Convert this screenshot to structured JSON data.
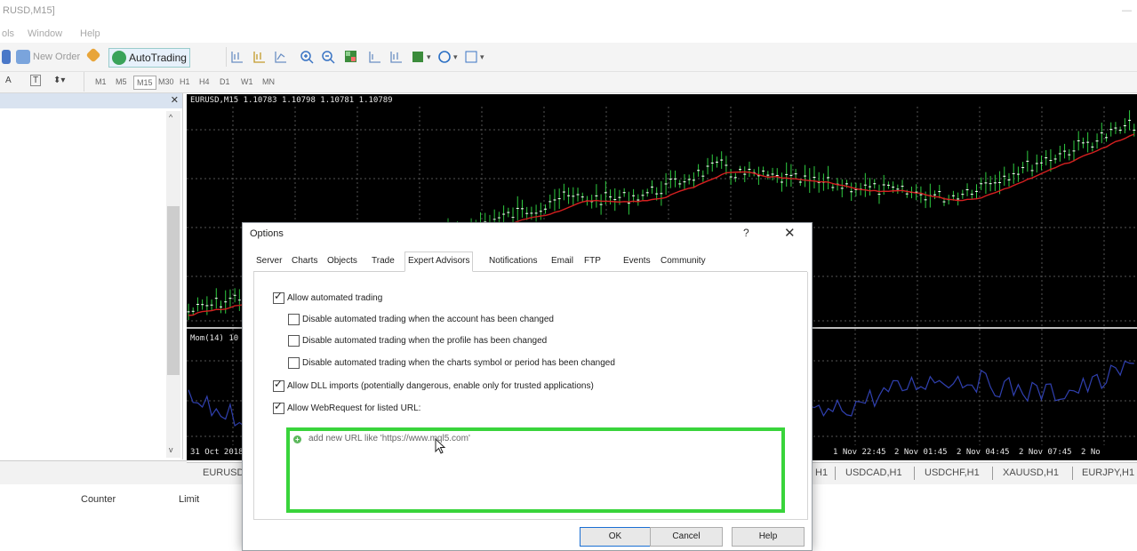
{
  "window": {
    "title": "RUSD,M15]",
    "minimize": "—"
  },
  "menu": [
    "ols",
    "Window",
    "Help"
  ],
  "toolbar": {
    "new_order": "New Order",
    "autotrading": "AutoTrading"
  },
  "timeframes": [
    "M1",
    "M5",
    "M15",
    "M30",
    "H1",
    "H4",
    "D1",
    "W1",
    "MN"
  ],
  "timeframe_selected": "M15",
  "chart": {
    "info": "EURUSD,M15  1.10783 1.10798 1.10781 1.10789",
    "indicator_label": "Mom(14) 10",
    "x_labels": [
      "31 Oct 2018",
      "1 Nov 22:45",
      "2 Nov 01:45",
      "2 Nov 04:45",
      "2 Nov 07:45",
      "2 No"
    ]
  },
  "chart_tabs": [
    "EURUSD",
    "H1",
    "USDCAD,H1",
    "USDCHF,H1",
    "XAUUSD,H1",
    "EURJPY,H1"
  ],
  "terminal": {
    "columns": [
      "Counter",
      "Limit"
    ]
  },
  "dialog": {
    "title": "Options",
    "help_symbol": "?",
    "close_symbol": "✕",
    "tabs": [
      "Server",
      "Charts",
      "Objects",
      "Trade",
      "Expert Advisors",
      "Notifications",
      "Email",
      "FTP",
      "Events",
      "Community"
    ],
    "active_tab": "Expert Advisors",
    "options": [
      {
        "label": "Allow automated trading",
        "checked": true
      },
      {
        "label": "Disable automated trading when the account has been changed",
        "checked": false
      },
      {
        "label": "Disable automated trading when the profile has been changed",
        "checked": false
      },
      {
        "label": "Disable automated trading when the charts symbol or period has been changed",
        "checked": false
      },
      {
        "label": "Allow DLL imports (potentially dangerous, enable only for trusted applications)",
        "checked": true
      },
      {
        "label": "Allow WebRequest for listed URL:",
        "checked": true
      }
    ],
    "url_placeholder": "add new URL like 'https://www.mql5.com'",
    "buttons": {
      "ok": "OK",
      "cancel": "Cancel",
      "help": "Help"
    }
  },
  "colors": {
    "highlight": "#39d43b",
    "chart_bg": "#000000",
    "candles": "#2ecc40",
    "moving_average": "#d62020",
    "momentum": "#3040b0"
  }
}
